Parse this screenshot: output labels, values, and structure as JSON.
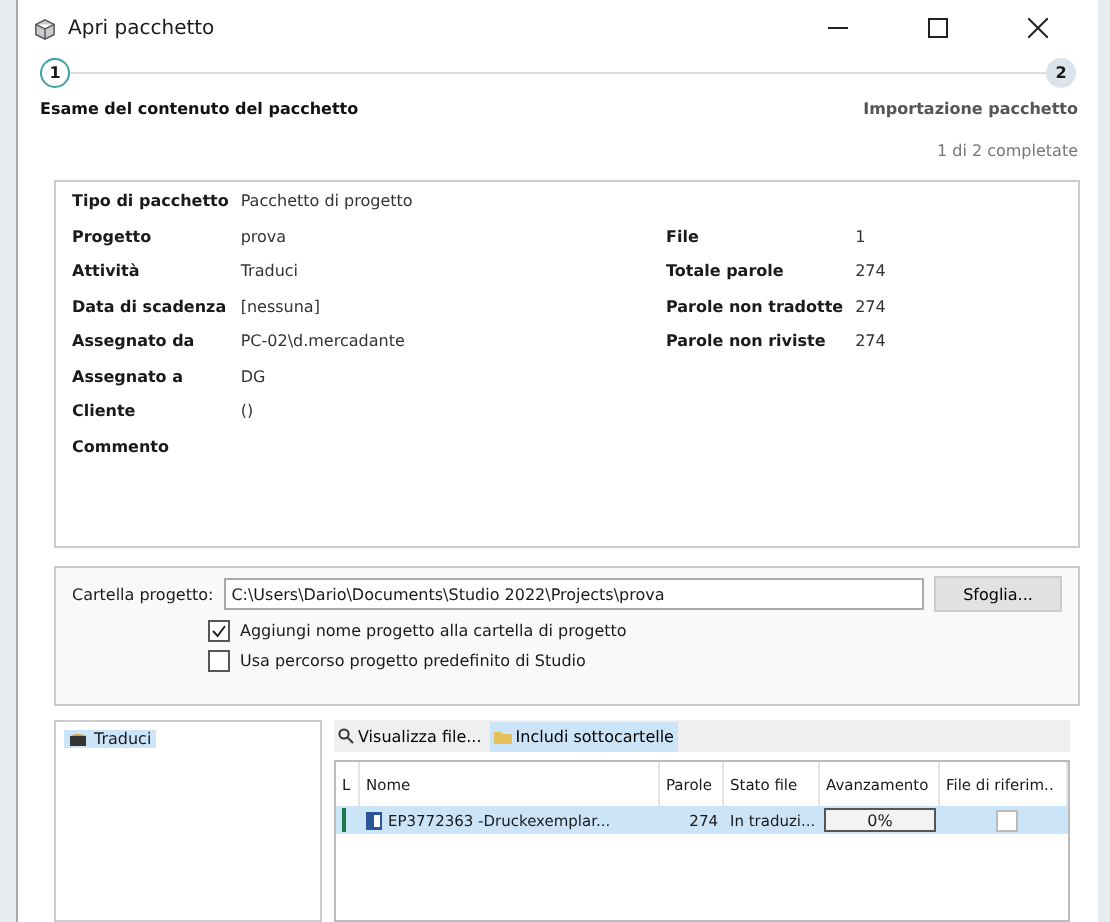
{
  "window": {
    "title": "Apri pacchetto"
  },
  "steps": [
    {
      "number": "1",
      "label": "Esame del contenuto del pacchetto",
      "selected": true
    },
    {
      "number": "2",
      "label": "Importazione pacchetto",
      "selected": false
    }
  ],
  "progress_text": "1 di 2 completate",
  "details_left": [
    {
      "label": "Tipo di pacchetto",
      "value": "Pacchetto di progetto"
    },
    {
      "label": "Progetto",
      "value": "prova"
    },
    {
      "label": "Attività",
      "value": "Traduci"
    },
    {
      "label": "Data di scadenza",
      "value": "[nessuna]"
    },
    {
      "label": "Assegnato da",
      "value": "PC-02\\d.mercadante"
    },
    {
      "label": "Assegnato a",
      "value": "DG"
    },
    {
      "label": "Cliente",
      "value": "()"
    },
    {
      "label": "Commento"
    }
  ],
  "details_right": [
    {
      "label": "File",
      "value": "1"
    },
    {
      "label": "Totale parole",
      "value": "274"
    },
    {
      "label": "Parole non tradotte",
      "value": "274"
    },
    {
      "label": "Parole non riviste",
      "value": "274"
    }
  ],
  "folder": {
    "label": "Cartella progetto:",
    "value": "C:\\Users\\Dario\\Documents\\Studio 2022\\Projects\\prova",
    "browse": "Sfoglia..."
  },
  "options": [
    {
      "label": "Aggiungi nome progetto alla cartella di progetto",
      "checked": true
    },
    {
      "label": "Usa percorso progetto predefinito di Studio",
      "checked": false
    }
  ],
  "tasks": [
    {
      "label": "Traduci",
      "selected": true
    }
  ],
  "toolbar": [
    {
      "label": "Visualizza file...",
      "kind": "search",
      "selected": false
    },
    {
      "label": "Includi sottocartelle",
      "kind": "folder",
      "selected": true
    }
  ],
  "table": {
    "columns": [
      "L",
      "Nome",
      "Parole",
      "Stato file",
      "Avanzamento",
      "File di riferim.."
    ],
    "rows": [
      {
        "name": "EP3772363  -Druckexemplar...",
        "words": "274",
        "status": "In traduzi...",
        "progress": "0%",
        "level": 0,
        "reference": false,
        "selected": true
      }
    ]
  }
}
